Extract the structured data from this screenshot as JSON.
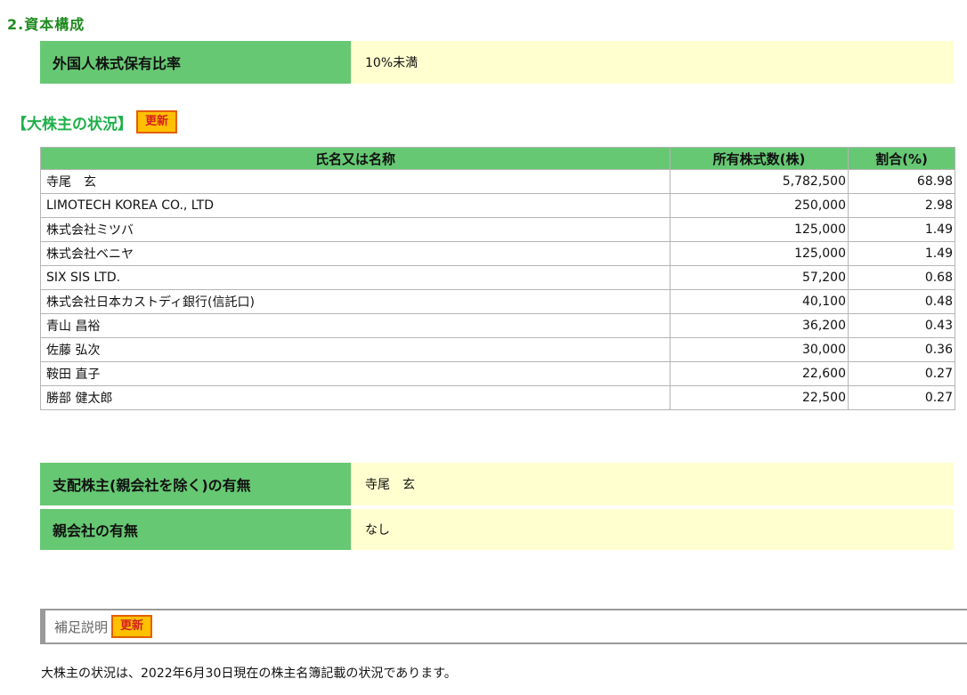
{
  "section_title": "2.資本構成",
  "foreign_ownership": {
    "label": "外国人株式保有比率",
    "value": "10%未満"
  },
  "major_shareholders": {
    "title": "【大株主の状況】",
    "update_label": "更新",
    "columns": [
      "氏名又は名称",
      "所有株式数(株)",
      "割合(%)"
    ],
    "rows": [
      [
        "寺尾　玄",
        "5,782,500",
        "68.98"
      ],
      [
        "LIMOTECH KOREA CO., LTD",
        "250,000",
        "2.98"
      ],
      [
        "株式会社ミツバ",
        "125,000",
        "1.49"
      ],
      [
        "株式会社ベニヤ",
        "125,000",
        "1.49"
      ],
      [
        "SIX SIS LTD.",
        "57,200",
        "0.68"
      ],
      [
        "株式会社日本カストディ銀行(信託口)",
        "40,100",
        "0.48"
      ],
      [
        "青山 昌裕",
        "36,200",
        "0.43"
      ],
      [
        "佐藤 弘次",
        "30,000",
        "0.36"
      ],
      [
        "鞍田 直子",
        "22,600",
        "0.27"
      ],
      [
        "勝部 健太郎",
        "22,500",
        "0.27"
      ]
    ]
  },
  "controlling_shareholder": {
    "label": "支配株主(親会社を除く)の有無",
    "value": "寺尾　玄"
  },
  "parent_company": {
    "label": "親会社の有無",
    "value": "なし"
  },
  "supplementary": {
    "title": "補足説明",
    "update_label": "更新",
    "text": "大株主の状況は、2022年6月30日現在の株主名簿記載の状況であります。"
  }
}
